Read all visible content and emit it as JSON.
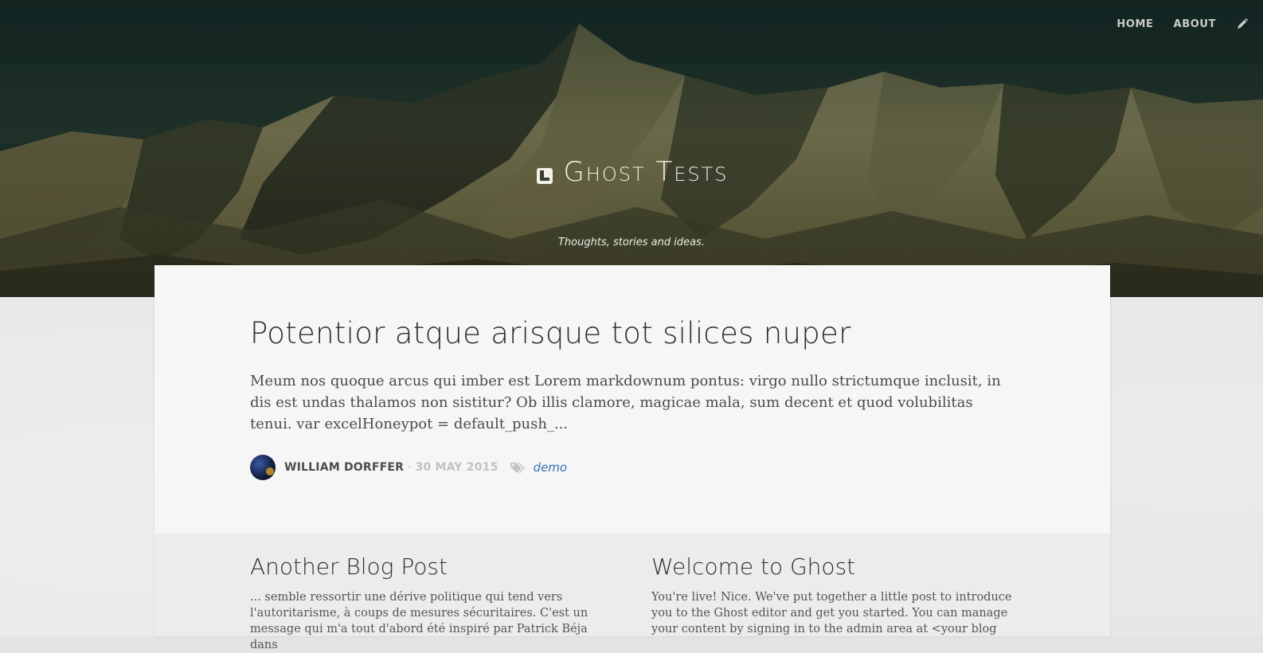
{
  "nav": {
    "home_label": "HOME",
    "about_label": "ABOUT",
    "edit_icon": "pencil-icon"
  },
  "site": {
    "title": "Ghost Tests",
    "logo_icon": "book-icon",
    "tagline": "Thoughts, stories and ideas."
  },
  "featured_post": {
    "title": "Potentior atque arisque tot silices nuper",
    "excerpt": "Meum nos quoque arcus qui imber est Lorem markdownum pontus: virgo nullo strictumque inclusit, in dis est undas thalamos non sistitur? Ob illis clamore, magicae mala, sum decent et quod volubilitas tenui. var excelHoneypot = default_push_...",
    "author": "WILLIAM DORFFER",
    "separator": "·",
    "date": "30 MAY 2015",
    "tags_icon": "tags-icon",
    "tag": "demo"
  },
  "posts": [
    {
      "title": "Another Blog Post",
      "excerpt": "... semble ressortir une dérive politique qui tend vers l'autoritarisme, à coups de mesures sécuritaires. C'est un message qui m'a tout d'abord été inspiré par Patrick Béja dans"
    },
    {
      "title": "Welcome to Ghost",
      "excerpt": "You're live! Nice. We've put together a little post to introduce you to the Ghost editor and get you started. You can manage your content by signing in to the admin area at <your blog"
    }
  ],
  "colors": {
    "accent_link": "#3b6fb8",
    "hero_overlay": "#1a2a24"
  }
}
